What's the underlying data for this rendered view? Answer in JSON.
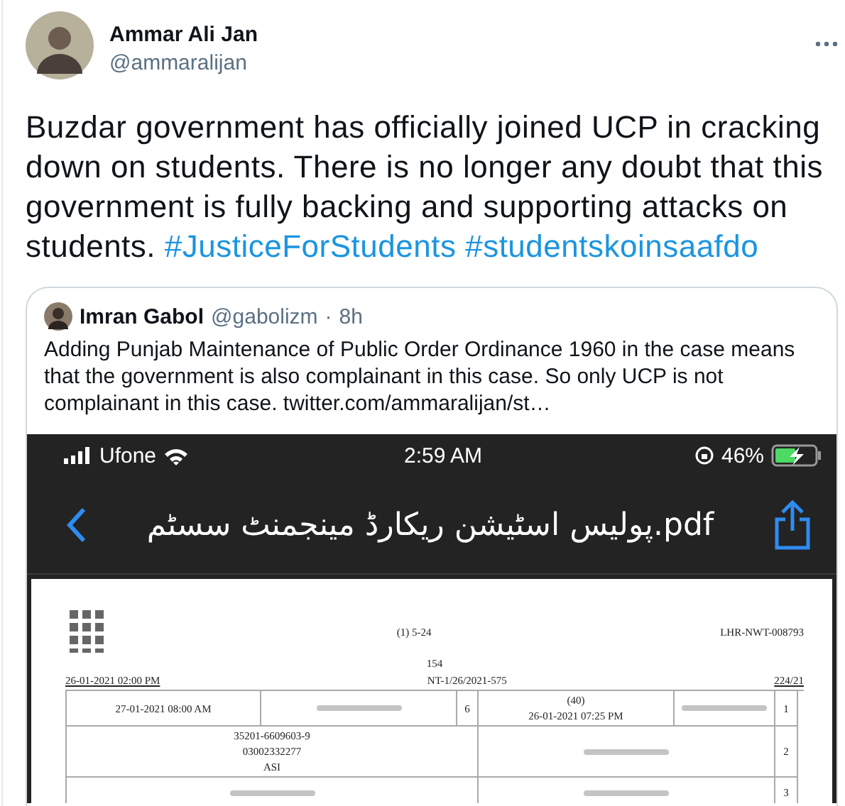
{
  "tweet": {
    "author": {
      "name": "Ammar Ali Jan",
      "handle": "@ammaralijan"
    },
    "text": "Buzdar government has officially joined UCP in cracking down on students. There is no longer any doubt that this government is fully backing and supporting attacks on students.",
    "hashtags": [
      "#JusticeForStudents",
      "#studentskoinsaafdo"
    ]
  },
  "quote": {
    "author": {
      "name": "Imran Gabol",
      "handle": "@gabolizm"
    },
    "separator": "·",
    "time": "8h",
    "text": "Adding Punjab Maintenance of Public Order Ordinance 1960 in the case means that the government is also complainant in this case. So only UCP is not complainant in this case.",
    "link": "twitter.com/ammaralijan/st…"
  },
  "phone": {
    "carrier": "Ufone",
    "time": "2:59 AM",
    "battery": "46%",
    "title": "پولیس اسٹیشن ریکارڈ مینجمنٹ سسٹم.pdf",
    "document": {
      "serial": "LHR-NWT-008793",
      "form": "(1) 5-24",
      "section": "154",
      "case": "224/21",
      "fir": "NT-1/26/2021-575",
      "report_time": "26-01-2021 02:00 PM",
      "rows": [
        {
          "number": "1",
          "lines": [
            "(40)",
            "26-01-2021 07:25 PM"
          ],
          "side_number": "6",
          "side_lines": [
            "27-01-2021 08:00 AM"
          ]
        },
        {
          "number": "2",
          "lines": [],
          "side_number": "",
          "side_lines": [
            "35201-6609603-9",
            "03002332277",
            "ASI"
          ]
        },
        {
          "number": "3",
          "lines": [],
          "side_number": "",
          "side_lines": []
        }
      ]
    }
  }
}
